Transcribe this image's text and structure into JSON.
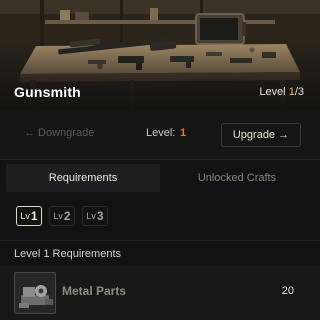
{
  "station": {
    "name": "Gunsmith",
    "level_prefix": "Level ",
    "current_level": "1",
    "level_suffix": "/3"
  },
  "level_bar": {
    "downgrade_label": "← Downgrade",
    "level_label": "Level:",
    "level_value": "1",
    "upgrade_label": "Upgrade →"
  },
  "tabs": [
    {
      "label": "Requirements",
      "active": true
    },
    {
      "label": "Unlocked Crafts",
      "active": false
    }
  ],
  "level_selectors": [
    {
      "prefix": "Lv",
      "number": "1",
      "selected": true
    },
    {
      "prefix": "Lv",
      "number": "2",
      "selected": false
    },
    {
      "prefix": "Lv",
      "number": "3",
      "selected": false
    }
  ],
  "requirements": {
    "title": "Level 1 Requirements",
    "items": [
      {
        "name": "Metal Parts",
        "quantity": "20",
        "icon": "metal-parts-icon"
      }
    ]
  },
  "colors": {
    "accent_yellow": "#f5c64b",
    "accent_orange": "#e9733d",
    "background": "#121212"
  }
}
